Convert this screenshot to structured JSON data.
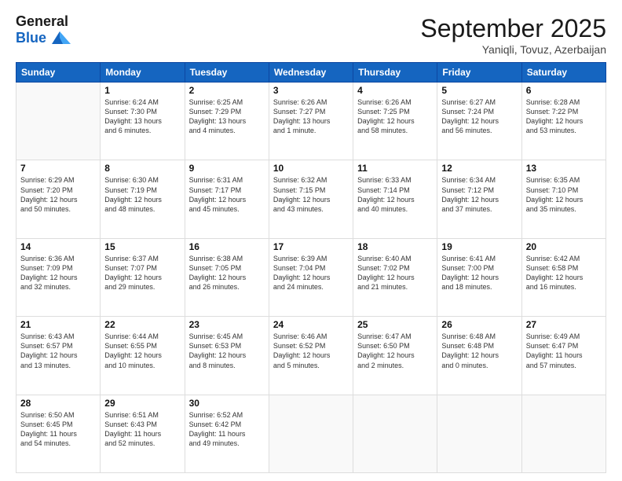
{
  "header": {
    "logo_line1": "General",
    "logo_line2": "Blue",
    "month_title": "September 2025",
    "location": "Yaniqli, Tovuz, Azerbaijan"
  },
  "weekdays": [
    "Sunday",
    "Monday",
    "Tuesday",
    "Wednesday",
    "Thursday",
    "Friday",
    "Saturday"
  ],
  "weeks": [
    [
      {
        "day": "",
        "info": ""
      },
      {
        "day": "1",
        "info": "Sunrise: 6:24 AM\nSunset: 7:30 PM\nDaylight: 13 hours\nand 6 minutes."
      },
      {
        "day": "2",
        "info": "Sunrise: 6:25 AM\nSunset: 7:29 PM\nDaylight: 13 hours\nand 4 minutes."
      },
      {
        "day": "3",
        "info": "Sunrise: 6:26 AM\nSunset: 7:27 PM\nDaylight: 13 hours\nand 1 minute."
      },
      {
        "day": "4",
        "info": "Sunrise: 6:26 AM\nSunset: 7:25 PM\nDaylight: 12 hours\nand 58 minutes."
      },
      {
        "day": "5",
        "info": "Sunrise: 6:27 AM\nSunset: 7:24 PM\nDaylight: 12 hours\nand 56 minutes."
      },
      {
        "day": "6",
        "info": "Sunrise: 6:28 AM\nSunset: 7:22 PM\nDaylight: 12 hours\nand 53 minutes."
      }
    ],
    [
      {
        "day": "7",
        "info": "Sunrise: 6:29 AM\nSunset: 7:20 PM\nDaylight: 12 hours\nand 50 minutes."
      },
      {
        "day": "8",
        "info": "Sunrise: 6:30 AM\nSunset: 7:19 PM\nDaylight: 12 hours\nand 48 minutes."
      },
      {
        "day": "9",
        "info": "Sunrise: 6:31 AM\nSunset: 7:17 PM\nDaylight: 12 hours\nand 45 minutes."
      },
      {
        "day": "10",
        "info": "Sunrise: 6:32 AM\nSunset: 7:15 PM\nDaylight: 12 hours\nand 43 minutes."
      },
      {
        "day": "11",
        "info": "Sunrise: 6:33 AM\nSunset: 7:14 PM\nDaylight: 12 hours\nand 40 minutes."
      },
      {
        "day": "12",
        "info": "Sunrise: 6:34 AM\nSunset: 7:12 PM\nDaylight: 12 hours\nand 37 minutes."
      },
      {
        "day": "13",
        "info": "Sunrise: 6:35 AM\nSunset: 7:10 PM\nDaylight: 12 hours\nand 35 minutes."
      }
    ],
    [
      {
        "day": "14",
        "info": "Sunrise: 6:36 AM\nSunset: 7:09 PM\nDaylight: 12 hours\nand 32 minutes."
      },
      {
        "day": "15",
        "info": "Sunrise: 6:37 AM\nSunset: 7:07 PM\nDaylight: 12 hours\nand 29 minutes."
      },
      {
        "day": "16",
        "info": "Sunrise: 6:38 AM\nSunset: 7:05 PM\nDaylight: 12 hours\nand 26 minutes."
      },
      {
        "day": "17",
        "info": "Sunrise: 6:39 AM\nSunset: 7:04 PM\nDaylight: 12 hours\nand 24 minutes."
      },
      {
        "day": "18",
        "info": "Sunrise: 6:40 AM\nSunset: 7:02 PM\nDaylight: 12 hours\nand 21 minutes."
      },
      {
        "day": "19",
        "info": "Sunrise: 6:41 AM\nSunset: 7:00 PM\nDaylight: 12 hours\nand 18 minutes."
      },
      {
        "day": "20",
        "info": "Sunrise: 6:42 AM\nSunset: 6:58 PM\nDaylight: 12 hours\nand 16 minutes."
      }
    ],
    [
      {
        "day": "21",
        "info": "Sunrise: 6:43 AM\nSunset: 6:57 PM\nDaylight: 12 hours\nand 13 minutes."
      },
      {
        "day": "22",
        "info": "Sunrise: 6:44 AM\nSunset: 6:55 PM\nDaylight: 12 hours\nand 10 minutes."
      },
      {
        "day": "23",
        "info": "Sunrise: 6:45 AM\nSunset: 6:53 PM\nDaylight: 12 hours\nand 8 minutes."
      },
      {
        "day": "24",
        "info": "Sunrise: 6:46 AM\nSunset: 6:52 PM\nDaylight: 12 hours\nand 5 minutes."
      },
      {
        "day": "25",
        "info": "Sunrise: 6:47 AM\nSunset: 6:50 PM\nDaylight: 12 hours\nand 2 minutes."
      },
      {
        "day": "26",
        "info": "Sunrise: 6:48 AM\nSunset: 6:48 PM\nDaylight: 12 hours\nand 0 minutes."
      },
      {
        "day": "27",
        "info": "Sunrise: 6:49 AM\nSunset: 6:47 PM\nDaylight: 11 hours\nand 57 minutes."
      }
    ],
    [
      {
        "day": "28",
        "info": "Sunrise: 6:50 AM\nSunset: 6:45 PM\nDaylight: 11 hours\nand 54 minutes."
      },
      {
        "day": "29",
        "info": "Sunrise: 6:51 AM\nSunset: 6:43 PM\nDaylight: 11 hours\nand 52 minutes."
      },
      {
        "day": "30",
        "info": "Sunrise: 6:52 AM\nSunset: 6:42 PM\nDaylight: 11 hours\nand 49 minutes."
      },
      {
        "day": "",
        "info": ""
      },
      {
        "day": "",
        "info": ""
      },
      {
        "day": "",
        "info": ""
      },
      {
        "day": "",
        "info": ""
      }
    ]
  ]
}
